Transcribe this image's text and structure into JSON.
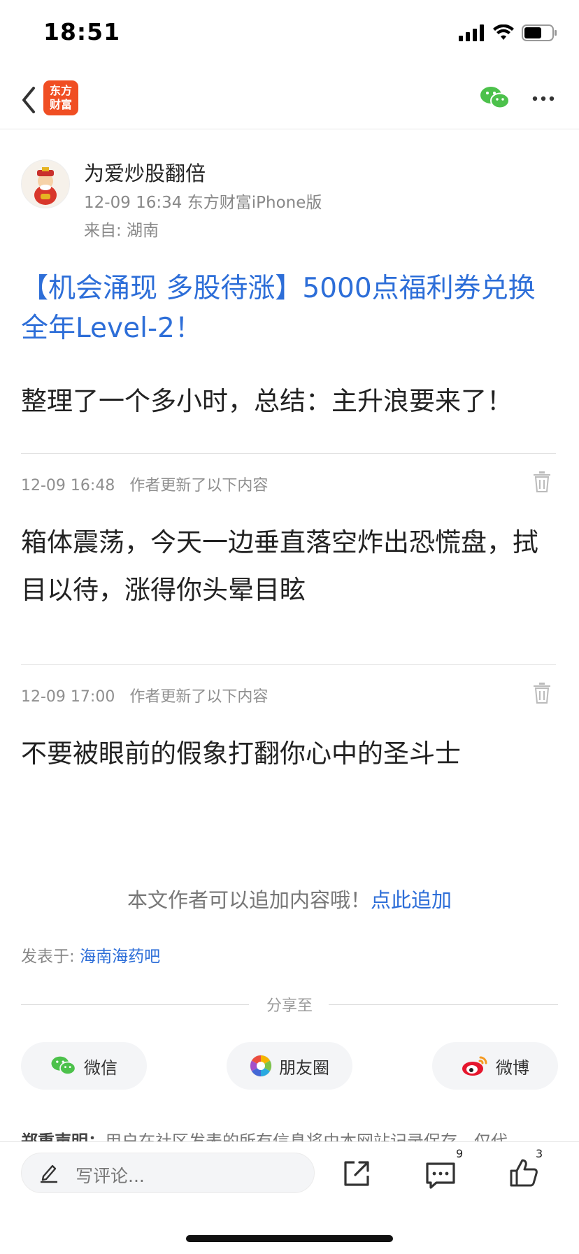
{
  "status_bar": {
    "time": "18:51"
  },
  "nav": {
    "logo_line1": "东方",
    "logo_line2": "财富"
  },
  "author": {
    "name": "为爱炒股翻倍",
    "meta": "12-09 16:34 东方财富iPhone版",
    "from": "来自: 湖南"
  },
  "post": {
    "title": "【机会涌现 多股待涨】5000点福利券兑换全年Level-2！",
    "body": "整理了一个多小时，总结：主升浪要来了！"
  },
  "updates": [
    {
      "time": "12-09 16:48",
      "label": "作者更新了以下内容",
      "text": "箱体震荡，今天一边垂直落空炸出恐慌盘，拭目以待，涨得你头晕目眩"
    },
    {
      "time": "12-09 17:00",
      "label": "作者更新了以下内容",
      "text": "不要被眼前的假象打翻你心中的圣斗士"
    }
  ],
  "append": {
    "prompt": "本文作者可以追加内容哦！",
    "link": "点此追加"
  },
  "posted_in": {
    "label": "发表于: ",
    "forum": "海南海药吧"
  },
  "share": {
    "label": "分享至",
    "wechat": "微信",
    "moments": "朋友圈",
    "weibo": "微博"
  },
  "disclaimer": {
    "bold": "郑重声明：",
    "text": "用户在社区发表的所有信息将由本网站记录保存，仅代"
  },
  "bottom_bar": {
    "comment_placeholder": "写评论...",
    "comment_count": "9",
    "like_count": "3"
  },
  "colors": {
    "link_blue": "#2d6ed8",
    "brand_orange": "#f04e23",
    "wechat_green": "#4cc14b"
  }
}
